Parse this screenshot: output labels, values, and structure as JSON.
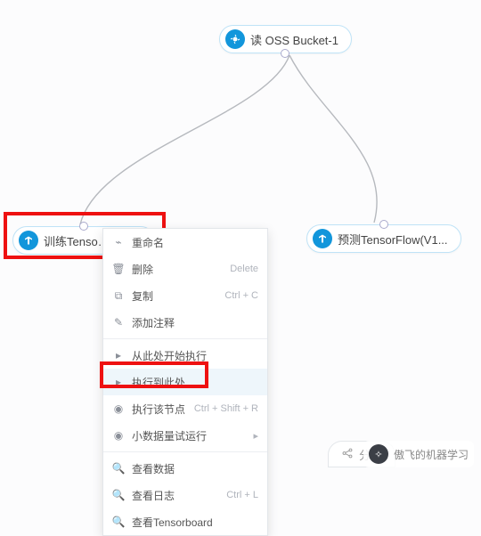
{
  "nodes": {
    "read_oss": {
      "label": "读 OSS Bucket-1"
    },
    "train_tf": {
      "label": "训练Tenso…"
    },
    "predict_tf": {
      "label": "预测TensorFlow(V1..."
    }
  },
  "context_menu": {
    "rename": {
      "label": "重命名",
      "shortcut": ""
    },
    "delete": {
      "label": "删除",
      "shortcut": "Delete"
    },
    "copy": {
      "label": "复制",
      "shortcut": "Ctrl + C"
    },
    "annotate": {
      "label": "添加注释",
      "shortcut": ""
    },
    "run_from": {
      "label": "从此处开始执行",
      "shortcut": ""
    },
    "run_to": {
      "label": "执行到此处",
      "shortcut": ""
    },
    "run_node": {
      "label": "执行该节点",
      "shortcut": "Ctrl + Shift + R"
    },
    "debug": {
      "label": "小数据量试运行",
      "shortcut": "",
      "submenu": true
    },
    "view_data": {
      "label": "查看数据",
      "shortcut": ""
    },
    "view_log": {
      "label": "查看日志",
      "shortcut": "Ctrl + L"
    },
    "view_tb": {
      "label": "查看Tensorboard",
      "shortcut": ""
    }
  },
  "share": {
    "label": "分享"
  },
  "watermark": {
    "text": "傲飞的机器学习"
  },
  "colors": {
    "accent": "#1296db",
    "highlight_border": "#e11"
  }
}
